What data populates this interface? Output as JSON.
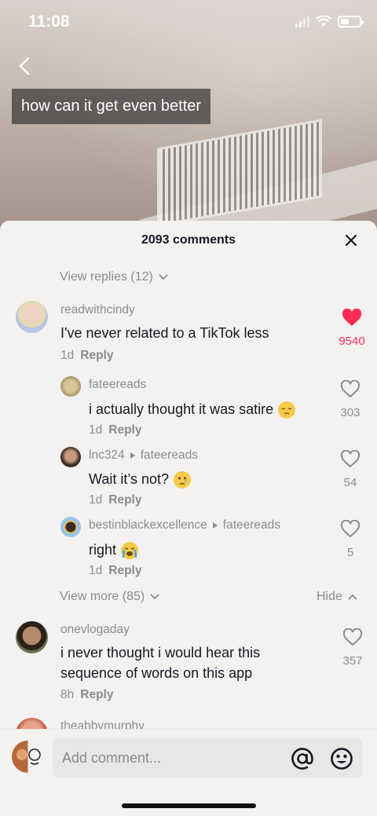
{
  "status_bar": {
    "time": "11:08"
  },
  "video": {
    "caption": "how can it get even better"
  },
  "comments_header": {
    "title": "2093 comments"
  },
  "view_replies": "View replies (12)",
  "comments": [
    {
      "username": "readwithcindy",
      "text": "I've never related to a TikTok less",
      "age": "1d",
      "reply_label": "Reply",
      "likes": "9540",
      "liked": true,
      "replies": [
        {
          "username": "fateereads",
          "reply_to": "",
          "text": "i actually thought it was satire",
          "emoji": "pensive-face",
          "age": "1d",
          "reply_label": "Reply",
          "likes": "303"
        },
        {
          "username": "lnc324",
          "reply_to": "fateereads",
          "text": "Wait it’s not?",
          "emoji": "crying-face",
          "age": "1d",
          "reply_label": "Reply",
          "likes": "54"
        },
        {
          "username": "bestinblackexcellence",
          "reply_to": "fateereads",
          "text": "right",
          "emoji": "loudly-crying-face",
          "age": "1d",
          "reply_label": "Reply",
          "likes": "5"
        }
      ],
      "view_more": "View more (85)",
      "hide": "Hide"
    },
    {
      "username": "onevlogaday",
      "text_line1": "i never thought i would hear this",
      "text_line2": "sequence of words on this app",
      "age": "8h",
      "reply_label": "Reply",
      "likes": "357",
      "liked": false
    },
    {
      "username": "theabbymurphy"
    }
  ],
  "composer": {
    "placeholder": "Add comment..."
  },
  "colors": {
    "liked": "#fe2c55",
    "secondary_text": "#8a8b91",
    "primary_text": "#161823"
  }
}
